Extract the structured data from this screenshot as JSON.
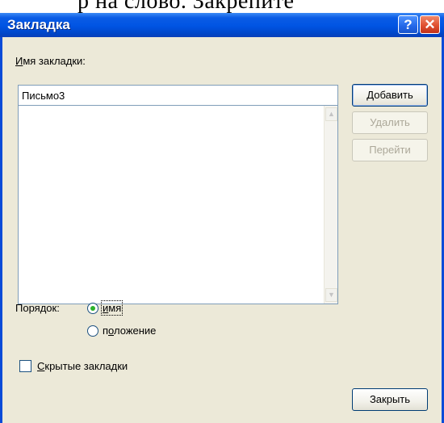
{
  "caption_fragment": "р на слово. Закрепите",
  "window": {
    "title": "Закладка",
    "help_glyph": "?",
    "close_glyph": "✕"
  },
  "bookmark_name": {
    "label": "Имя закладки:",
    "value": "Письмо3"
  },
  "bookmark_list": {
    "items": [],
    "scroll_up_glyph": "▲",
    "scroll_down_glyph": "▼"
  },
  "buttons": {
    "add": "Добавить",
    "delete": "Удалить",
    "goto": "Перейти",
    "close": "Закрыть"
  },
  "sort": {
    "label": "Порядок:",
    "options": [
      {
        "label": "имя",
        "selected": true
      },
      {
        "label": "положение",
        "selected": false
      }
    ]
  },
  "hidden_bookmarks": {
    "label": "Скрытые закладки",
    "checked": false
  }
}
